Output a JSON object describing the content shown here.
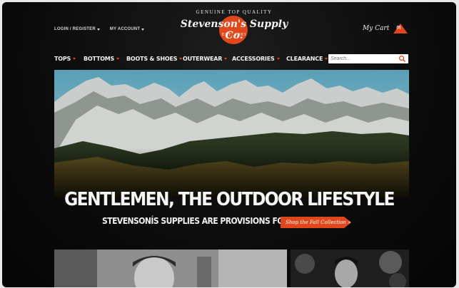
{
  "header": {
    "login_label": "LOGIN / REGISTER",
    "account_label": "MY ACCOUNT",
    "logo_tagline": "GENUINE TOP QUALITY",
    "logo_name": "Stevenson's Supply Co.",
    "logo_est": "EST. 1983",
    "cart_label": "My Cart",
    "cart_count": "(0)"
  },
  "nav": {
    "items": [
      {
        "label": "TOPS"
      },
      {
        "label": "BOTTOMS"
      },
      {
        "label": "BOOTS & SHOES"
      },
      {
        "label": "OUTERWEAR"
      },
      {
        "label": "ACCESSORIES"
      },
      {
        "label": "CLEARANCE"
      }
    ],
    "search_placeholder": "Search..."
  },
  "hero": {
    "headline": "GENTLEMEN, THE OUTDOOR LIFESTYLE",
    "subhead": "STEVENSONÍS SUPPLIES ARE PROVISIONS FOR MEN",
    "cta_label": "Shop the Fall Collection »"
  },
  "colors": {
    "accent": "#e0481c",
    "background": "#0c0c0c"
  }
}
